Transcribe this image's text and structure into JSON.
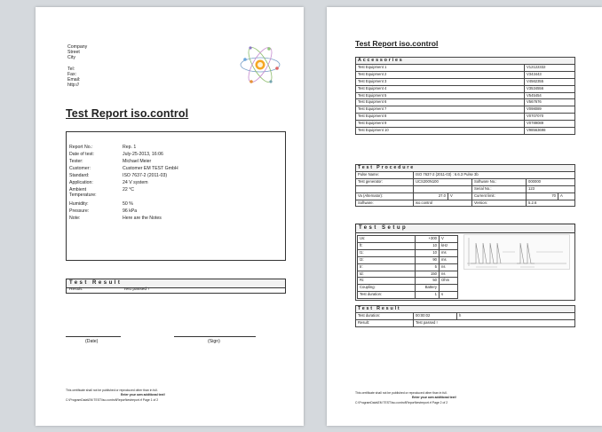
{
  "page1": {
    "address": [
      "Company",
      "Street",
      "City",
      "",
      "Tel:",
      "Fax:",
      "Email:",
      "http://"
    ],
    "title": "Test Report iso.control",
    "info": [
      {
        "label": "Report No.:",
        "value": "Rep. 1"
      },
      {
        "label": "Date of test:",
        "value": "July-25-2013, 16:06"
      },
      {
        "label": "Tester:",
        "value": "Michael Meier"
      },
      {
        "label": "Customer:",
        "value": "Customer EM TEST GmbH"
      },
      {
        "label": "Standard:",
        "value": "ISO 7637-2 (2011-03)"
      },
      {
        "label": "Application:",
        "value": "24 V system"
      },
      {
        "label": "Ambient Temperature:",
        "value": "22 °C"
      },
      {
        "label": "Humidity:",
        "value": "50 %"
      },
      {
        "label": "Pressure:",
        "value": "96 kPa"
      },
      {
        "label": "Note:",
        "value": "Here are the Notes"
      }
    ],
    "result_heading": "Test Result",
    "result_label": "Result:",
    "result_value": "Test passed !",
    "date_label": "(Date)",
    "sign_label": "(Sign)",
    "footer_line1": "This certificate shall not be published or reproduced other than in full.",
    "footer_line2": "Enter your own additional text!",
    "footer_line3": "C:\\ProgramData\\EM TEST\\iso.control\\Report\\testreport.rf Page 1 of 2"
  },
  "page2": {
    "title": "Test Report iso.control",
    "accessories_heading": "Accessories",
    "accessories": [
      {
        "name": "Test Equipment 1",
        "id": "V12122332"
      },
      {
        "name": "Test Equipment 2",
        "id": "V343443"
      },
      {
        "name": "Test Equipment 3",
        "id": "V4562355"
      },
      {
        "name": "Test Equipment 4",
        "id": "V3534556"
      },
      {
        "name": "Test Equipment 5",
        "id": "V545454"
      },
      {
        "name": "Test Equipment 6",
        "id": "V567676"
      },
      {
        "name": "Test Equipment 7",
        "id": "V098089"
      },
      {
        "name": "Test Equipment 8",
        "id": "V0707070"
      },
      {
        "name": "Test Equipment 9",
        "id": "V0789089"
      },
      {
        "name": "Test Equipment 10",
        "id": "V98563698"
      }
    ],
    "procedure_heading": "Test Procedure",
    "procedure": {
      "pulse_name_label": "Pulse Name:",
      "pulse_name_value": "ISO 7637-2 (2011-03) : 6.6.3 Pulse 3b",
      "generator_label": "Test generator:",
      "generator_value": "UCS200N100",
      "software_no_label": "Software No.:",
      "software_no_value": "000000",
      "serial_no_label": "Serial No.:",
      "serial_no_value": "123",
      "va_label": "Va (Alternator):",
      "va_value": "27.0",
      "va_unit": "V",
      "current_label": "Current limit:",
      "current_value": "70",
      "current_unit": "A",
      "software_label": "Software:",
      "software_value": "iso.control",
      "version_label": "Version:",
      "version_value": "5.2.6"
    },
    "setup_heading": "Test Setup",
    "setup": [
      {
        "label": "Us:",
        "value": "+300",
        "unit": "V"
      },
      {
        "label": "ft:",
        "value": "10",
        "unit": "kHz"
      },
      {
        "label": "t1:",
        "value": "10",
        "unit": "ms"
      },
      {
        "label": "t3:",
        "value": "90",
        "unit": "ms"
      },
      {
        "label": "tr:",
        "value": "5",
        "unit": "ns"
      },
      {
        "label": "td:",
        "value": "150",
        "unit": "ns"
      },
      {
        "label": "Ri:",
        "value": "50",
        "unit": "Ohm"
      },
      {
        "label": "Coupling:",
        "value": "Battery",
        "unit": ""
      },
      {
        "label": "Test duration:",
        "value": "1",
        "unit": "s"
      }
    ],
    "result_heading": "Test Result",
    "duration_label": "Test duration:",
    "duration_value": "00:00:02",
    "duration_unit": "h",
    "result_label": "Result:",
    "result_value": "Test passed !",
    "footer_line1": "This certificate shall not be published or reproduced other than in full.",
    "footer_line2": "Enter your own additional text!",
    "footer_line3": "C:\\ProgramData\\EM TEST\\iso.control\\Report\\testreport.rf Page 2 of 2"
  }
}
